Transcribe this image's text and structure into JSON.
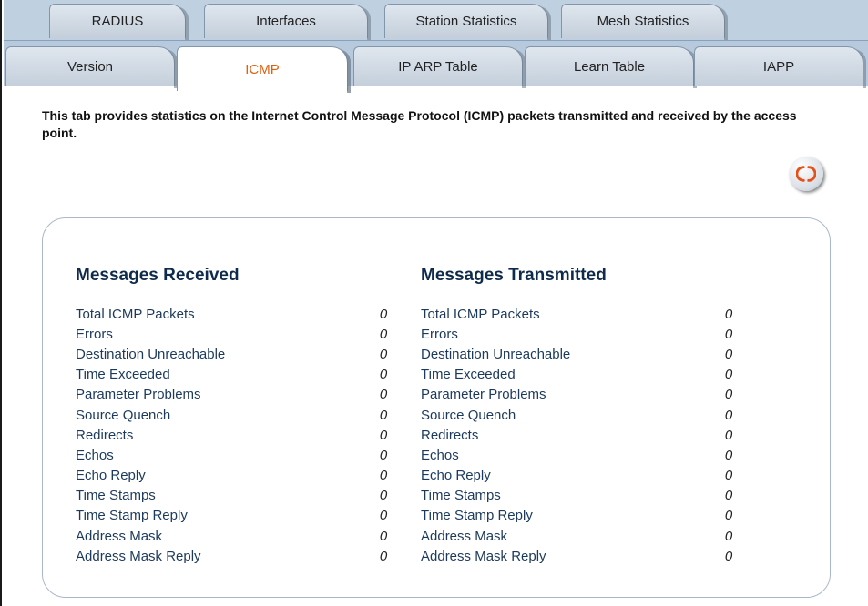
{
  "tabs_row1": [
    {
      "label": "RADIUS"
    },
    {
      "label": "Interfaces"
    },
    {
      "label": "Station Statistics"
    },
    {
      "label": "Mesh Statistics"
    }
  ],
  "tabs_row2": [
    {
      "label": "Version"
    },
    {
      "label": "ICMP",
      "active": true
    },
    {
      "label": "IP ARP Table"
    },
    {
      "label": "Learn Table"
    },
    {
      "label": "IAPP"
    }
  ],
  "description": "This tab provides statistics on the Internet Control Message Protocol (ICMP) packets transmitted and received by the access point.",
  "refresh_icon": "refresh-icon",
  "colors": {
    "accent": "#e06010",
    "heading": "#0f2b4c",
    "tab_bg": "#bfd0e0"
  },
  "received": {
    "title": "Messages Received",
    "rows": [
      {
        "label": "Total ICMP Packets",
        "value": "0"
      },
      {
        "label": "Errors",
        "value": "0"
      },
      {
        "label": "Destination Unreachable",
        "value": "0"
      },
      {
        "label": "Time Exceeded",
        "value": "0"
      },
      {
        "label": "Parameter Problems",
        "value": "0"
      },
      {
        "label": "Source Quench",
        "value": "0"
      },
      {
        "label": "Redirects",
        "value": "0"
      },
      {
        "label": "Echos",
        "value": "0"
      },
      {
        "label": "Echo Reply",
        "value": "0"
      },
      {
        "label": "Time Stamps",
        "value": "0"
      },
      {
        "label": "Time Stamp Reply",
        "value": "0"
      },
      {
        "label": "Address Mask",
        "value": "0"
      },
      {
        "label": "Address Mask Reply",
        "value": "0"
      }
    ]
  },
  "transmitted": {
    "title": "Messages Transmitted",
    "rows": [
      {
        "label": "Total ICMP Packets",
        "value": "0"
      },
      {
        "label": "Errors",
        "value": "0"
      },
      {
        "label": "Destination Unreachable",
        "value": "0"
      },
      {
        "label": "Time Exceeded",
        "value": "0"
      },
      {
        "label": "Parameter Problems",
        "value": "0"
      },
      {
        "label": "Source Quench",
        "value": "0"
      },
      {
        "label": "Redirects",
        "value": "0"
      },
      {
        "label": "Echos",
        "value": "0"
      },
      {
        "label": "Echo Reply",
        "value": "0"
      },
      {
        "label": "Time Stamps",
        "value": "0"
      },
      {
        "label": "Time Stamp Reply",
        "value": "0"
      },
      {
        "label": "Address Mask",
        "value": "0"
      },
      {
        "label": "Address Mask Reply",
        "value": "0"
      }
    ]
  }
}
